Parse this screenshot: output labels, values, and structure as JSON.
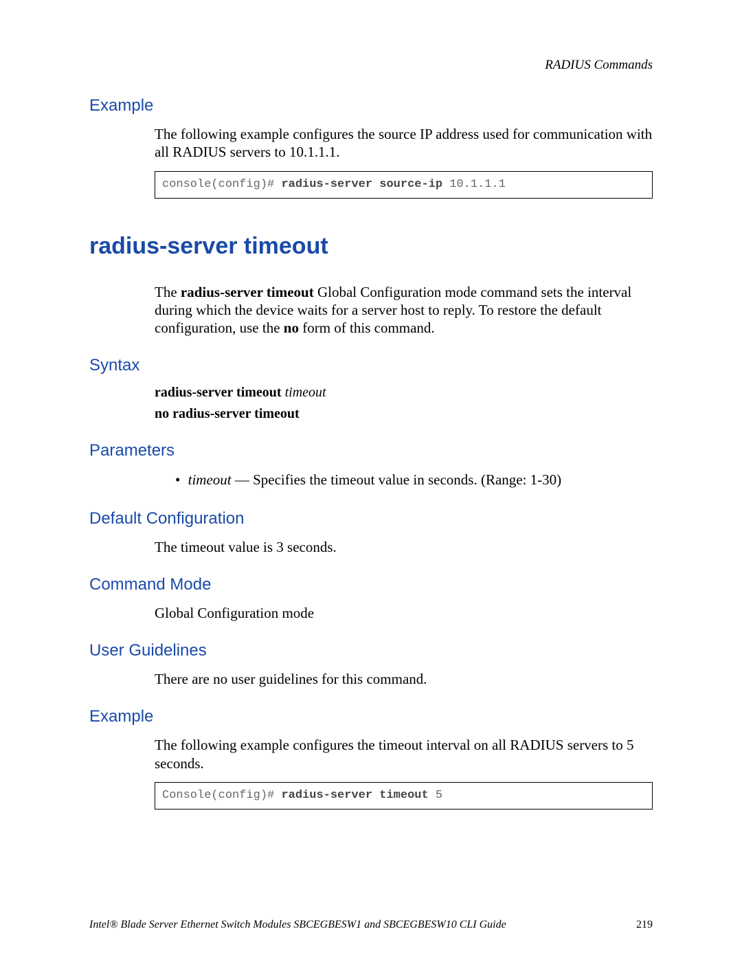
{
  "header": {
    "section": "RADIUS Commands"
  },
  "example1": {
    "heading": "Example",
    "text": "The following example configures the source IP address used for communication with all RADIUS servers to 10.1.1.1.",
    "code_prompt": "console(config)# ",
    "code_cmd": "radius-server source-ip ",
    "code_arg": "10.1.1.1"
  },
  "command": {
    "title": "radius-server timeout",
    "intro_pre": "The ",
    "intro_cmd": "radius-server timeout",
    "intro_post": " Global Configuration mode command sets the interval during which the device waits for a server host to reply. To restore the default configuration, use the ",
    "intro_no": "no",
    "intro_end": " form of this command."
  },
  "syntax": {
    "heading": "Syntax",
    "line1_bold": "radius-server timeout ",
    "line1_ital": "timeout",
    "line2_bold": "no radius-server timeout"
  },
  "parameters": {
    "heading": "Parameters",
    "p1_name": "timeout",
    "p1_desc": " — Specifies the timeout value in seconds. (Range: 1-30)"
  },
  "default_cfg": {
    "heading": "Default Configuration",
    "text": "The timeout value is 3 seconds."
  },
  "command_mode": {
    "heading": "Command Mode",
    "text": "Global Configuration mode"
  },
  "user_guidelines": {
    "heading": "User Guidelines",
    "text": "There are no user guidelines for this command."
  },
  "example2": {
    "heading": "Example",
    "text": "The following example configures the timeout interval on all RADIUS servers to 5 seconds.",
    "code_prompt": "Console(config)# ",
    "code_cmd": "radius-server timeout ",
    "code_arg": "5"
  },
  "footer": {
    "title": "Intel® Blade Server Ethernet Switch Modules SBCEGBESW1 and SBCEGBESW10 CLI Guide",
    "page": "219"
  }
}
